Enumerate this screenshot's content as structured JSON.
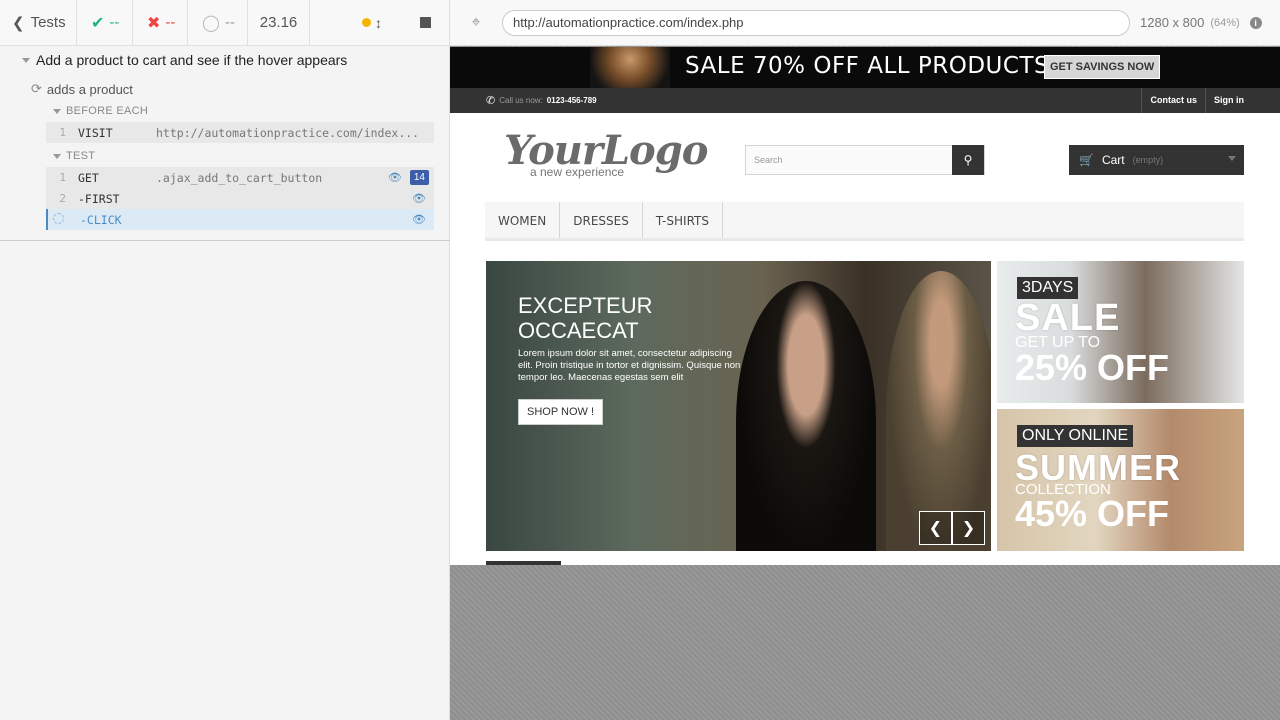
{
  "reporter": {
    "back_label": "Tests",
    "passed": "--",
    "failed": "--",
    "pending": "--",
    "duration": "23.16",
    "suite_title": "Add a product to cart and see if the hover appears",
    "test_title": "adds a product",
    "before_each_label": "BEFORE EACH",
    "test_label": "TEST",
    "commands": [
      {
        "num": "1",
        "name": "VISIT",
        "message": "http://automationpractice.com/index..."
      },
      {
        "num": "1",
        "name": "GET",
        "message": ".ajax_add_to_cart_button",
        "count": "14"
      },
      {
        "num": "2",
        "name": "-FIRST",
        "message": ""
      },
      {
        "num": "",
        "name": "-CLICK",
        "message": ""
      }
    ]
  },
  "aut": {
    "url": "http://automationpractice.com/index.php",
    "viewport": "1280 x 800",
    "scale": "(64%)"
  },
  "site": {
    "promo_text": "SALE 70% OFF ALL PRODUCTS",
    "promo_button": "GET SAVINGS NOW",
    "call_label": "Call us now:",
    "phone": "0123-456-789",
    "contact": "Contact us",
    "signin": "Sign in",
    "logo_main": "YourLogo",
    "logo_sub": "a new experience",
    "search_placeholder": "Search",
    "cart_label": "Cart",
    "cart_status": "(empty)",
    "menu": [
      "WOMEN",
      "DRESSES",
      "T-SHIRTS"
    ],
    "hero_title_1": "EXCEPTEUR",
    "hero_title_2": "OCCAECAT",
    "hero_text": "Lorem ipsum dolor sit amet, consectetur adipiscing elit. Proin tristique in tortor et dignissim. Quisque non tempor leo. Maecenas egestas sem elit",
    "hero_button": "SHOP NOW !",
    "banner1": {
      "tag": "3DAYS",
      "line1": "SALE",
      "line2": "GET UP TO",
      "line3": "25% OFF"
    },
    "banner2": {
      "tag": "ONLY ONLINE",
      "line1": "SUMMER",
      "line2": "COLLECTION",
      "line3": "45% OFF"
    }
  }
}
